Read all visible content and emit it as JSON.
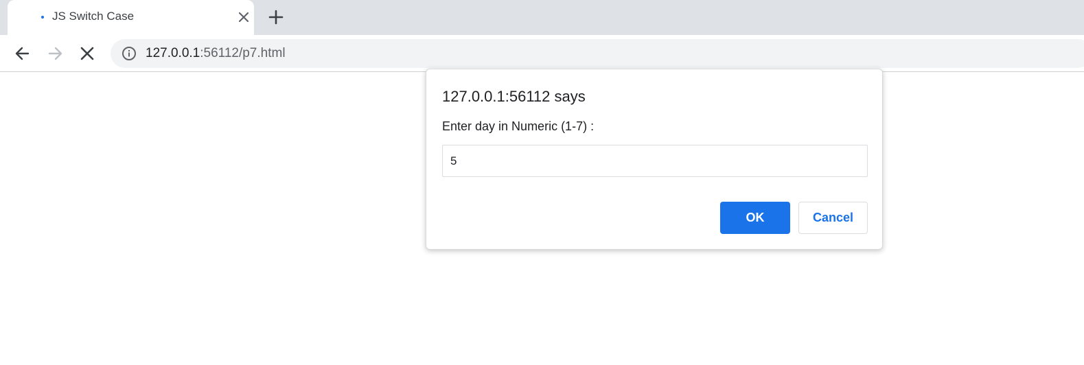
{
  "browser": {
    "tab": {
      "title": "JS Switch Case",
      "favicon_color": "#1a73e8",
      "close_icon": "close-icon"
    },
    "new_tab_icon": "plus-icon",
    "nav": {
      "back_icon": "arrow-left-icon",
      "forward_icon": "arrow-right-icon",
      "stop_icon": "close-icon"
    },
    "address_bar": {
      "security_icon": "info-circle-icon",
      "url_host": "127.0.0.1",
      "url_rest": ":56112/p7.html"
    }
  },
  "dialog": {
    "title": "127.0.0.1:56112 says",
    "message": "Enter day in Numeric (1-7) :",
    "input_value": "5",
    "ok_label": "OK",
    "cancel_label": "Cancel",
    "accent_color": "#1a73e8"
  }
}
